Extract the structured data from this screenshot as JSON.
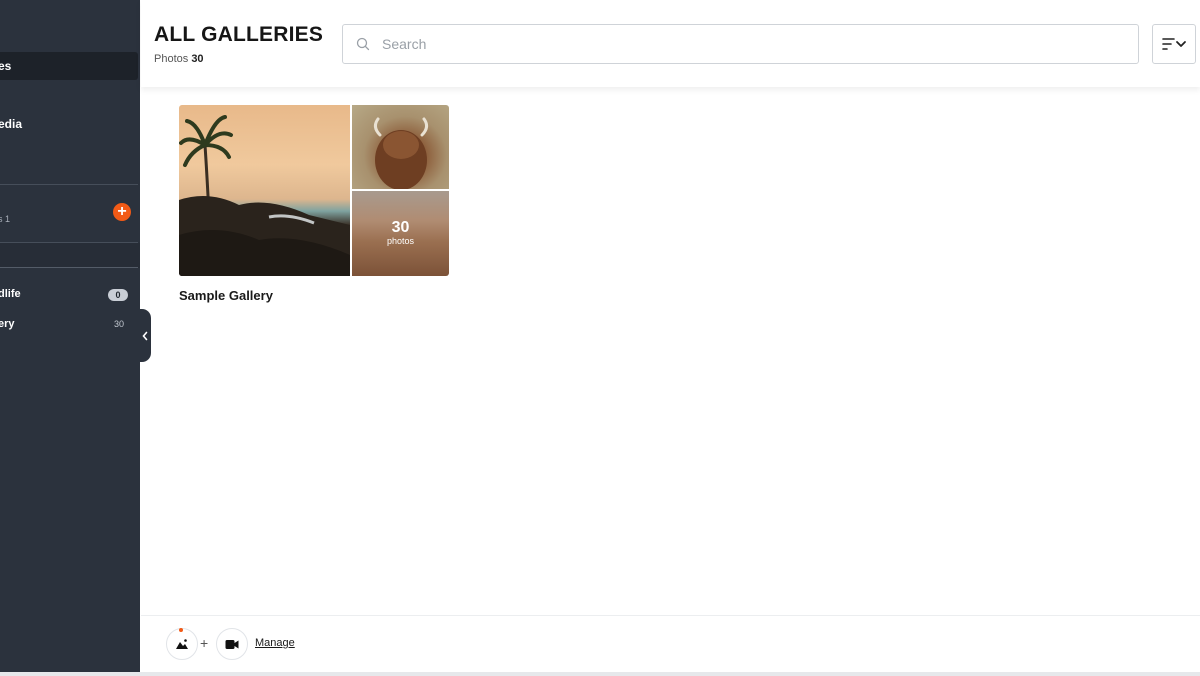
{
  "sidebar": {
    "active_item_label": "es",
    "media_label": "edia",
    "sub_label": "s 1",
    "albums": [
      {
        "label": "dlife",
        "count": "0"
      },
      {
        "label": "ery",
        "count": "30"
      }
    ],
    "add_icon": "plus-icon",
    "collapse_icon": "chevron-left-icon"
  },
  "header": {
    "title": "ALL GALLERIES",
    "photos_label": "Photos",
    "photos_count": "30",
    "search_placeholder": "Search",
    "sort_icon": "sort-icon"
  },
  "gallery": {
    "title": "Sample Gallery",
    "photo_count": "30",
    "photo_word": "photos"
  },
  "footer": {
    "plus": "+",
    "manage_label": "Manage"
  },
  "colors": {
    "accent": "#f25a16",
    "sidebar_bg": "#2b323d"
  }
}
